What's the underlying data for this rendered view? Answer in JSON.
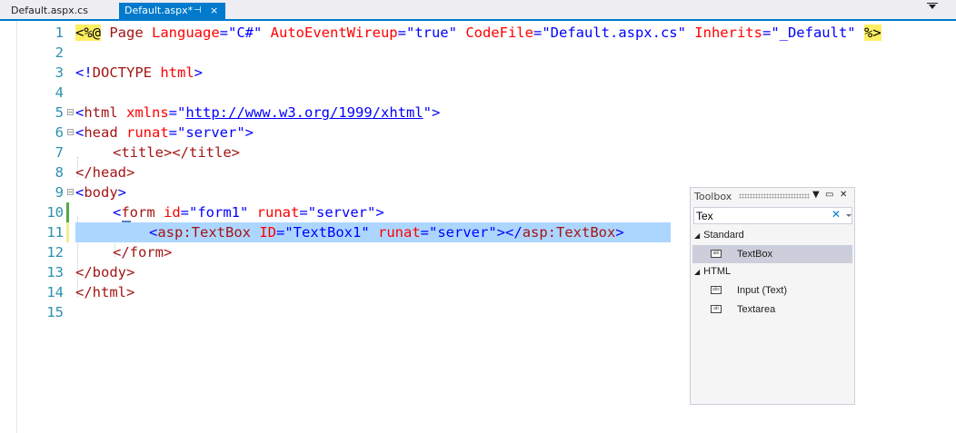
{
  "tabs": [
    {
      "label": "Default.aspx.cs",
      "active": false
    },
    {
      "label": "Default.aspx*",
      "active": true,
      "pin": "⊣",
      "close": "×"
    }
  ],
  "editor": {
    "lines": [
      {
        "num": "1"
      },
      {
        "num": "2"
      },
      {
        "num": "3"
      },
      {
        "num": "4"
      },
      {
        "num": "5"
      },
      {
        "num": "6"
      },
      {
        "num": "7"
      },
      {
        "num": "8"
      },
      {
        "num": "9"
      },
      {
        "num": "10"
      },
      {
        "num": "11"
      },
      {
        "num": "12"
      },
      {
        "num": "13"
      },
      {
        "num": "14"
      },
      {
        "num": "15"
      }
    ],
    "code": {
      "l1": {
        "open": "<%@",
        "page": " Page ",
        "lang_attr": "Language",
        "eq": "=",
        "lang_val": "\"C#\"",
        "aew_attr": " AutoEventWireup",
        "aew_val": "\"true\"",
        "cf_attr": " CodeFile",
        "cf_val": "\"Default.aspx.cs\"",
        "inh_attr": " Inherits",
        "inh_val": "\"_Default\"",
        "close": "%>"
      },
      "l3": {
        "lt": "<!",
        "doctype": "DOCTYPE",
        "html": " html",
        "gt": ">"
      },
      "l5": {
        "lt": "<",
        "tag": "html",
        "attr": " xmlns",
        "eq": "=",
        "q1": "\"",
        "url": "http://www.w3.org/1999/xhtml",
        "q2": "\"",
        "gt": ">"
      },
      "l6": {
        "lt": "<",
        "tag": "head",
        "attr": " runat",
        "eq": "=",
        "val": "\"server\"",
        "gt": ">"
      },
      "l7": {
        "text": "<title></title>"
      },
      "l8": {
        "text": "</head>"
      },
      "l9": {
        "lt": "<",
        "tag": "body",
        "gt": ">"
      },
      "l10": {
        "lt": "<",
        "tag": "form",
        "id_attr": " id",
        "eq": "=",
        "id_val": "\"form1\"",
        "runat_attr": " runat",
        "runat_val": "\"server\"",
        "gt": ">"
      },
      "l11": {
        "lt": "<",
        "tag": "asp:TextBox",
        "id_attr": " ID",
        "eq": "=",
        "id_val": "\"TextBox1\"",
        "runat_attr": " runat",
        "runat_val": "\"server\"",
        "gt": ">",
        "close_tag": "</",
        "close_name": "asp:TextBox",
        "close_gt": ">"
      },
      "l12": {
        "text": "</form>"
      },
      "l13": {
        "text": "</body>"
      },
      "l14": {
        "text": "</html>"
      }
    }
  },
  "toolbox": {
    "title": "Toolbox",
    "search_value": "Tex",
    "clear_glyph": "✕",
    "controls": {
      "dropdown": "▼",
      "maximize": "▭",
      "close": "✕"
    },
    "categories": [
      {
        "name": "Standard",
        "items": [
          {
            "label": "TextBox",
            "icon": "abl",
            "selected": true
          }
        ]
      },
      {
        "name": "HTML",
        "items": [
          {
            "label": "Input (Text)",
            "icon": "abc",
            "selected": false
          },
          {
            "label": "Textarea",
            "icon": "ab",
            "selected": false
          }
        ]
      }
    ],
    "expand_glyph": "◢"
  },
  "colors": {
    "accent": "#007acc",
    "line_numbers": "#2b91af",
    "selection": "#add6ff",
    "keyword": "#0000ff",
    "tag": "#a31515",
    "attribute": "#ff0000"
  }
}
